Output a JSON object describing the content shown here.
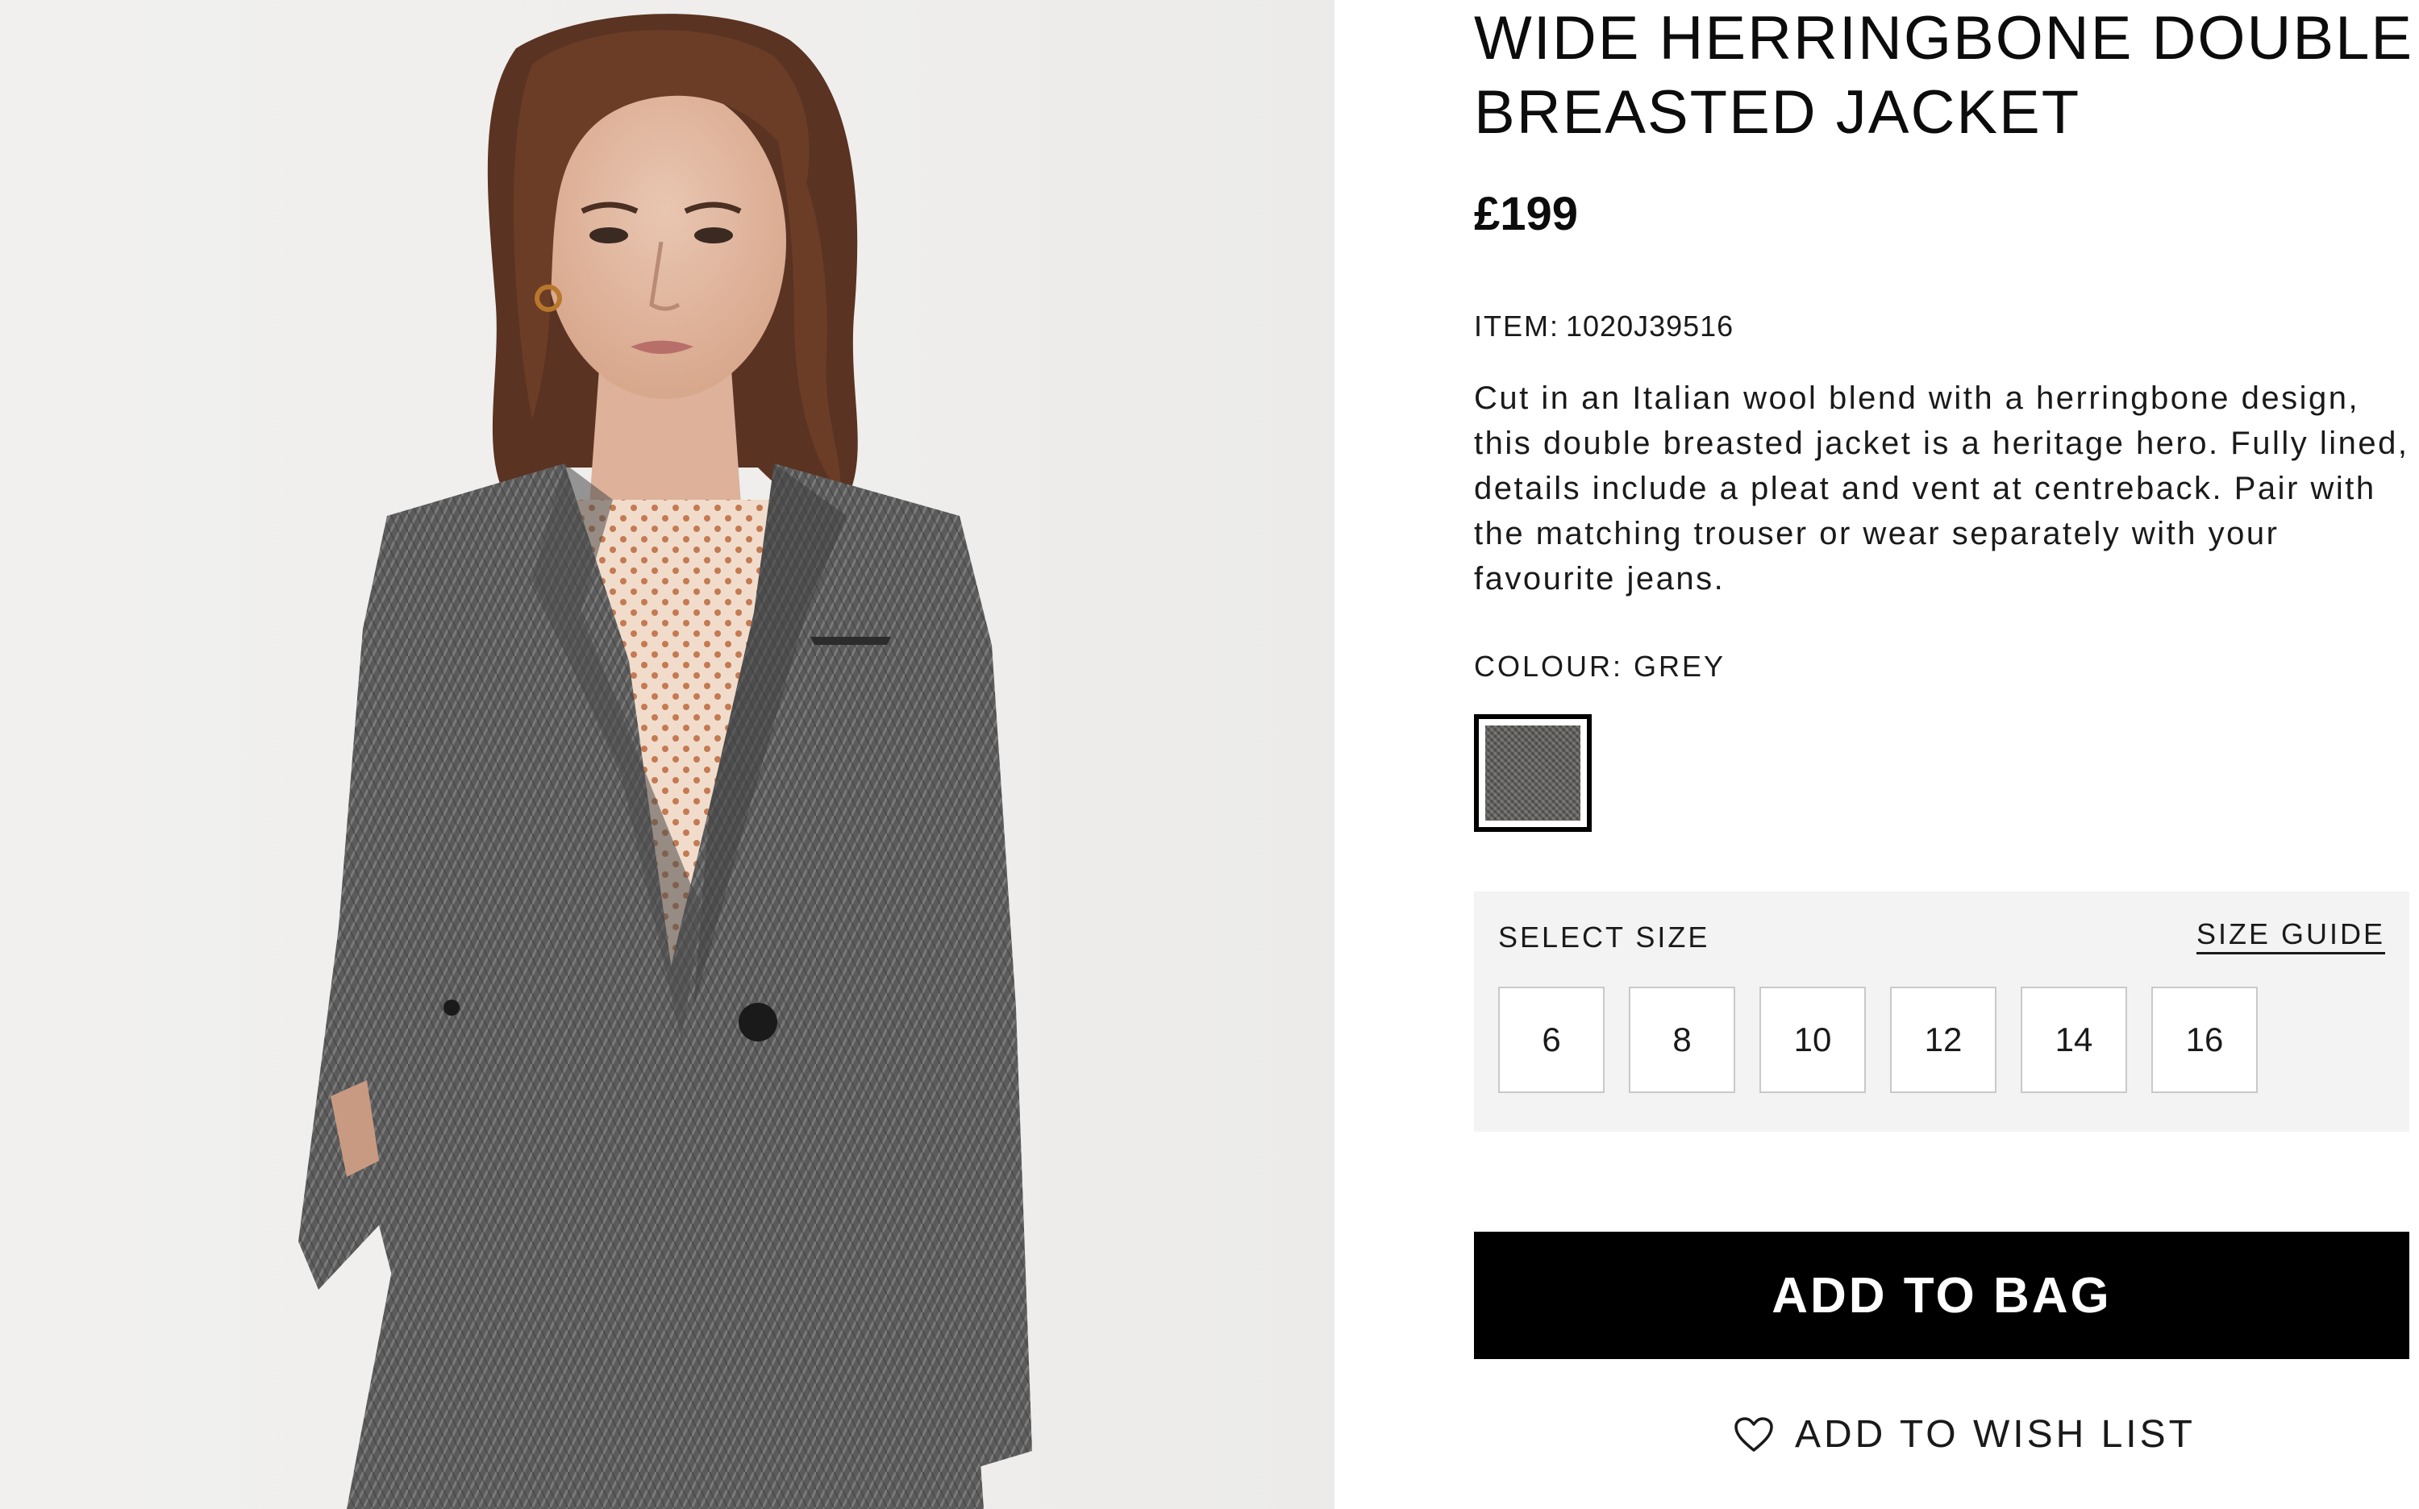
{
  "product": {
    "title": "WIDE HERRINGBONE DOUBLE BREASTED JACKET",
    "price": "£199",
    "item_label": "ITEM:",
    "item_code": "1020J39516",
    "description": "Cut in an Italian wool blend with a herringbone design, this double breasted jacket is a heritage hero. Fully lined, details include a pleat and vent at centreback. Pair with the matching trouser or wear separately with your favourite jeans.",
    "colour_label": "COLOUR: GREY",
    "swatch_color": "#5c5a57"
  },
  "size_selector": {
    "label": "SELECT SIZE",
    "guide_link": "SIZE GUIDE",
    "sizes": [
      "6",
      "8",
      "10",
      "12",
      "14",
      "16"
    ]
  },
  "actions": {
    "add_to_bag": "ADD TO BAG",
    "add_to_wishlist": "ADD TO WISH LIST",
    "wishlist_icon": "heart-outline-icon"
  },
  "colors": {
    "primary_button": "#000000",
    "size_panel_bg": "#f3f3f3",
    "photo_bg": "#efeeec"
  }
}
